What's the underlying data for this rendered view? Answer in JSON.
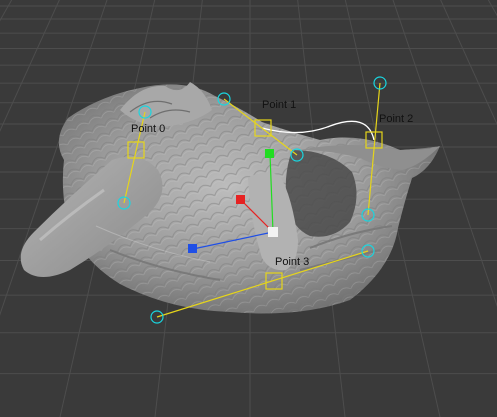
{
  "viewport": {
    "background": "#3a3a3a",
    "grid_color": "#4d4d4d",
    "grid_major_color": "#575757",
    "model": "feathered-wing-sculpture"
  },
  "colors": {
    "handle_line": "#e6d51a",
    "handle_circle": "#19d6e0",
    "connection_curve": "#ffffff",
    "gizmo_x": "#1f4fe6",
    "gizmo_y": "#22dd22",
    "gizmo_z": "#e62222",
    "label_text": "#111111"
  },
  "control_points": [
    {
      "label": "Point 0",
      "icon": "square-handle-icon"
    },
    {
      "label": "Point 1",
      "icon": "square-handle-icon"
    },
    {
      "label": "Point 2",
      "icon": "square-handle-icon"
    },
    {
      "label": "Point 3",
      "icon": "square-handle-icon"
    }
  ],
  "gizmo": {
    "icon": "transform-gizmo-icon"
  }
}
